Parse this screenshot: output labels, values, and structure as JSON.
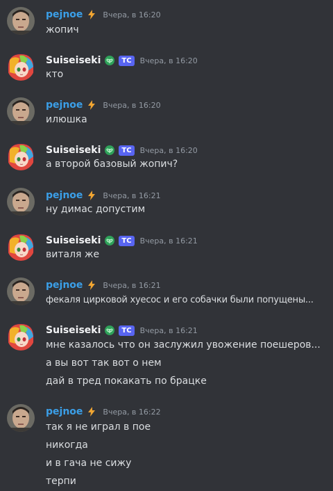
{
  "users": {
    "pejnoe": {
      "name": "pejnoe",
      "color": "#3b9fe8",
      "badge_icon": "lightning-icon"
    },
    "suiseiseki": {
      "name": "Suiseiseki",
      "color": "#f2f3f5",
      "badge_icon": "leaf-icon",
      "tag": "TC"
    }
  },
  "messages": [
    {
      "author": "pejnoe",
      "time": "Вчера, в 16:20",
      "lines": [
        "жопич"
      ]
    },
    {
      "author": "Suiseiseki",
      "time": "Вчера, в 16:20",
      "lines": [
        "кто"
      ]
    },
    {
      "author": "pejnoe",
      "time": "Вчера, в 16:20",
      "lines": [
        "илюшка"
      ]
    },
    {
      "author": "Suiseiseki",
      "time": "Вчера, в 16:20",
      "lines": [
        "а второй базовый жопич?"
      ]
    },
    {
      "author": "pejnoe",
      "time": "Вчера, в 16:21",
      "lines": [
        "ну димас допустим"
      ]
    },
    {
      "author": "Suiseiseki",
      "time": "Вчера, в 16:21",
      "lines": [
        "виталя же"
      ]
    },
    {
      "author": "pejnoe",
      "time": "Вчера, в 16:21",
      "lines": [
        "фекаля цирковой хуесос и его собачки были попущены..."
      ]
    },
    {
      "author": "Suiseiseki",
      "time": "Вчера, в 16:21",
      "lines": [
        "мне казалось что он заслужил увожение поешеров...",
        "а вы вот так вот о нем",
        "дай в тред покакать по брацке"
      ]
    },
    {
      "author": "pejnoe",
      "time": "Вчера, в 16:22",
      "lines": [
        "так я не играл в пое",
        "никогда",
        "и в гача не сижу",
        "терпи"
      ]
    }
  ]
}
